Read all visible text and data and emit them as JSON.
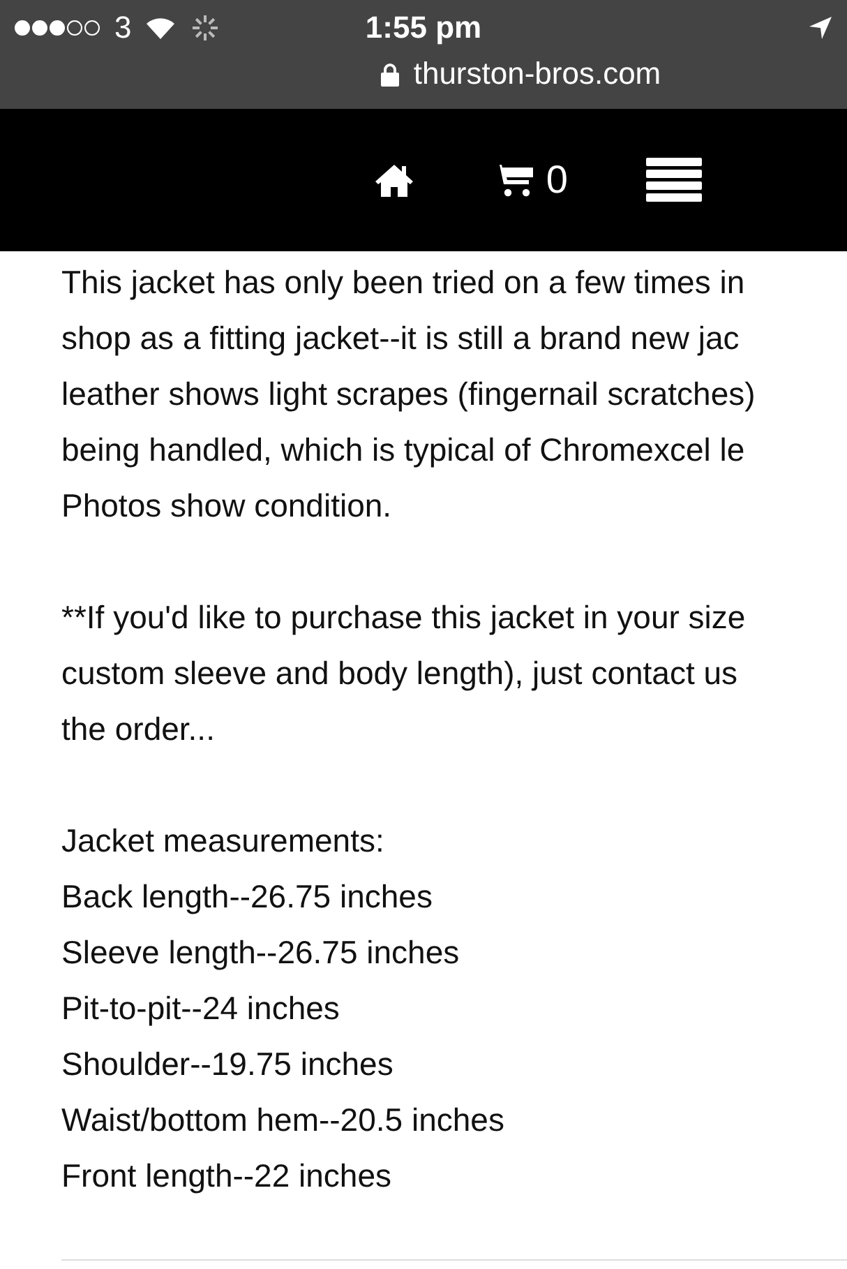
{
  "status_bar": {
    "carrier": "3",
    "time": "1:55 pm",
    "url": "thurston-bros.com"
  },
  "nav": {
    "cart_count": "0"
  },
  "paragraphs": [
    {
      "lines": [
        "This jacket has only been tried on a few times in",
        "shop as a fitting jacket--it is still a brand new jac",
        "leather shows light scrapes (fingernail scratches)",
        "being handled, which is typical of Chromexcel le",
        "Photos show condition."
      ]
    },
    {
      "lines": [
        "**If you'd like to purchase this jacket in your size",
        "custom sleeve and body length), just contact us",
        "the order..."
      ]
    },
    {
      "lines": [
        "Jacket measurements:",
        "Back length--26.75 inches",
        "Sleeve length--26.75 inches",
        "Pit-to-pit--24 inches",
        "Shoulder--19.75 inches",
        "Waist/bottom hem--20.5 inches",
        "Front length--22 inches"
      ]
    }
  ]
}
